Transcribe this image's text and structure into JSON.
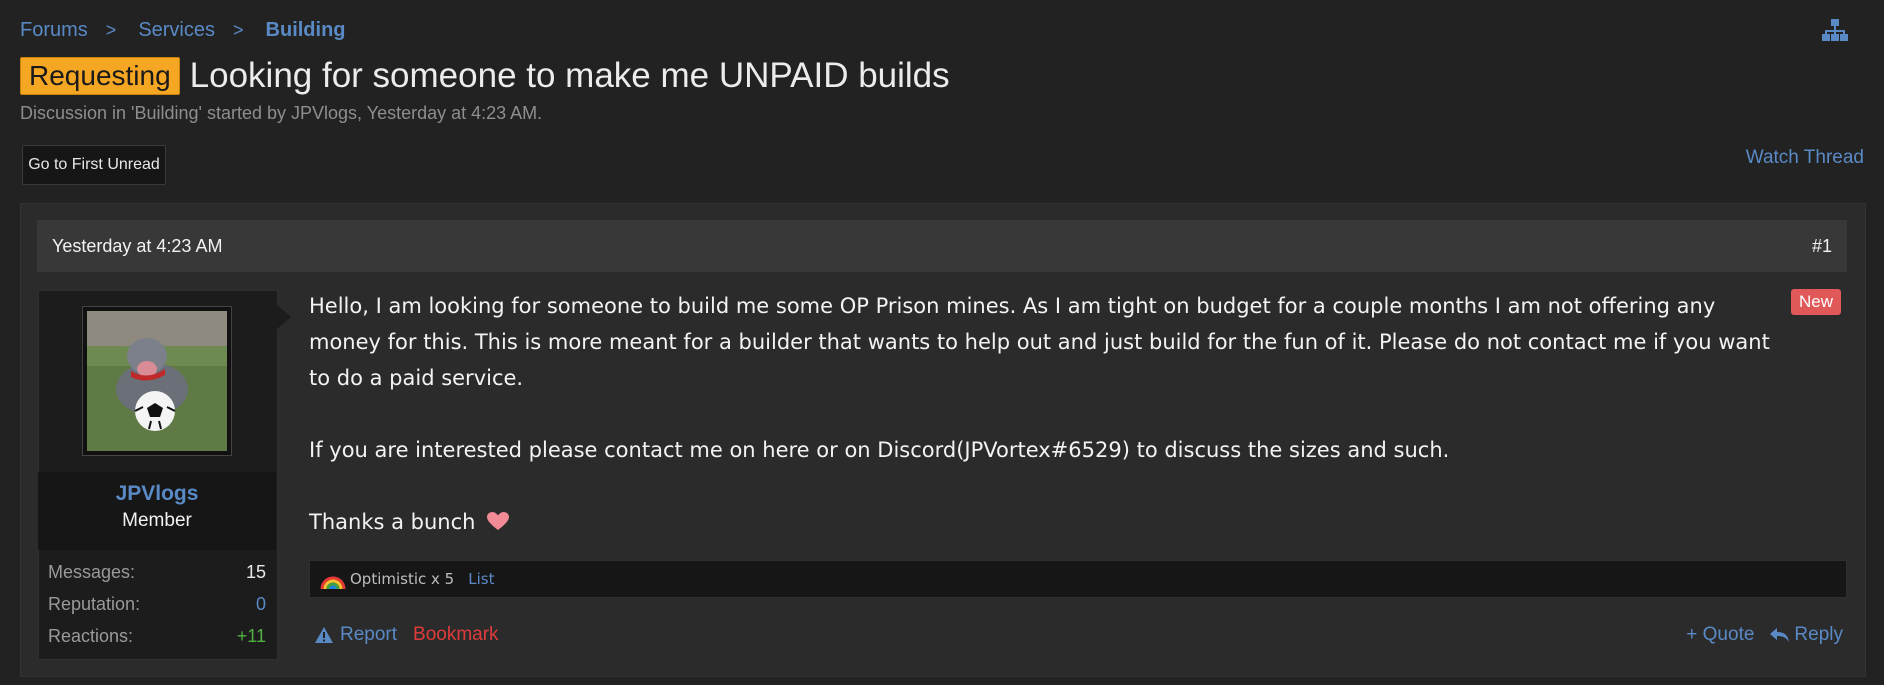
{
  "breadcrumb": {
    "items": [
      "Forums",
      "Services",
      "Building"
    ]
  },
  "thread": {
    "prefix": "Requesting",
    "title": "Looking for someone to make me UNPAID builds",
    "meta": "Discussion in 'Building' started by JPVlogs, Yesterday at 4:23 AM."
  },
  "controls": {
    "first_unread": "Go to First Unread",
    "watch_thread": "Watch Thread"
  },
  "post": {
    "date": "Yesterday at 4:23 AM",
    "number": "#1",
    "new_badge": "New",
    "paragraphs": [
      "Hello, I am looking for someone to build me some OP Prison mines. As I am tight on budget for a couple months I am not offering any money for this. This is more meant for a builder that wants to help out and just build for the fun of it. Please do not contact me if you want to do a paid service.",
      "If you are interested please contact me on here or on Discord(JPVortex#6529) to discuss the sizes and such.",
      "Thanks a bunch"
    ],
    "reactions": {
      "summary": "Optimistic x 5",
      "list_label": "List"
    },
    "footer": {
      "report": "Report",
      "bookmark": "Bookmark",
      "quote": "+ Quote",
      "reply": "Reply"
    }
  },
  "user": {
    "name": "JPVlogs",
    "title": "Member",
    "stats": [
      {
        "label": "Messages:",
        "value": "15"
      },
      {
        "label": "Reputation:",
        "value": "0"
      },
      {
        "label": "Reactions:",
        "value": "+11"
      }
    ]
  },
  "colors": {
    "accent": "#5a8ac6",
    "prefix": "#f5a623",
    "new_badge": "#e05858",
    "bookmark": "#e03b3b",
    "positive": "#52b043"
  },
  "icons": [
    "sitemap-icon",
    "heart-icon",
    "rainbow-icon",
    "warning-icon",
    "reply-icon"
  ]
}
